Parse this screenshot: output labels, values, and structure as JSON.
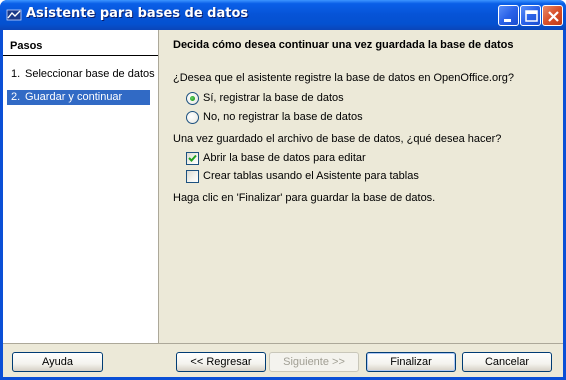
{
  "window": {
    "title": "Asistente para bases de datos",
    "titlebar_color": "#0a5fe8",
    "icon": "openoffice-app-icon"
  },
  "sidebar": {
    "title": "Pasos",
    "steps": [
      {
        "num": "1.",
        "label": "Seleccionar base de datos",
        "selected": false
      },
      {
        "num": "2.",
        "label": "Guardar y continuar",
        "selected": true
      }
    ],
    "selected_color": "#316ac5"
  },
  "main": {
    "heading": "Decida cómo desea continuar una vez guardada la base de datos",
    "register_question": "¿Desea que el asistente registre la base de datos en OpenOffice.org?",
    "register_options": [
      {
        "label": "Sí, registrar la base de datos",
        "checked": true
      },
      {
        "label": "No, no registrar la base de datos",
        "checked": false
      }
    ],
    "after_question": "Una vez guardado el archivo de base de datos, ¿qué desea hacer?",
    "after_options": [
      {
        "label": "Abrir la base de datos para editar",
        "checked": true
      },
      {
        "label": "Crear tablas usando el Asistente para tablas",
        "checked": false
      }
    ],
    "final_note": "Haga clic en 'Finalizar' para guardar la base de datos."
  },
  "footer": {
    "help": "Ayuda",
    "back": "<< Regresar",
    "next": "Siguiente >>",
    "finish": "Finalizar",
    "cancel": "Cancelar"
  }
}
